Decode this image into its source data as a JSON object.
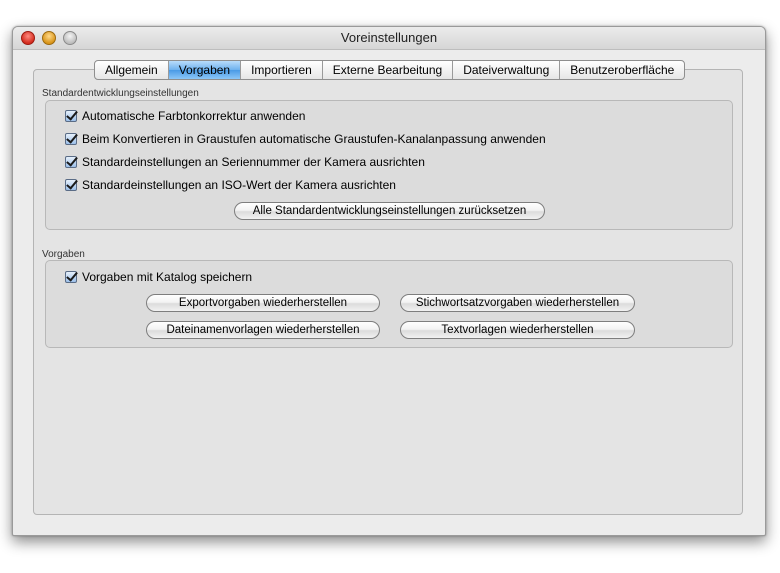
{
  "window": {
    "title": "Voreinstellungen"
  },
  "tabs": [
    {
      "label": "Allgemein",
      "selected": false
    },
    {
      "label": "Vorgaben",
      "selected": true
    },
    {
      "label": "Importieren",
      "selected": false
    },
    {
      "label": "Externe Bearbeitung",
      "selected": false
    },
    {
      "label": "Dateiverwaltung",
      "selected": false
    },
    {
      "label": "Benutzeroberfläche",
      "selected": false
    }
  ],
  "standard_group": {
    "label": "Standardentwicklungseinstellungen",
    "checkboxes": [
      {
        "label": "Automatische Farbtonkorrektur anwenden",
        "checked": true
      },
      {
        "label": "Beim Konvertieren in Graustufen automatische Graustufen-Kanalanpassung anwenden",
        "checked": true
      },
      {
        "label": "Standardeinstellungen an Seriennummer der Kamera ausrichten",
        "checked": true
      },
      {
        "label": "Standardeinstellungen an ISO-Wert der Kamera ausrichten",
        "checked": true
      }
    ],
    "reset_button": "Alle Standardentwicklungseinstellungen zurücksetzen"
  },
  "presets_group": {
    "label": "Vorgaben",
    "checkbox": {
      "label": "Vorgaben mit Katalog speichern",
      "checked": true
    },
    "buttons": {
      "export": "Exportvorgaben wiederherstellen",
      "keywords": "Stichwortsatzvorgaben wiederherstellen",
      "filenames": "Dateinamenvorlagen wiederherstellen",
      "text": "Textvorlagen wiederherstellen"
    }
  },
  "colors": {
    "tab_selected": "#6db1ee",
    "close_button": "#d42c1e",
    "minimize_button": "#d9951a"
  }
}
